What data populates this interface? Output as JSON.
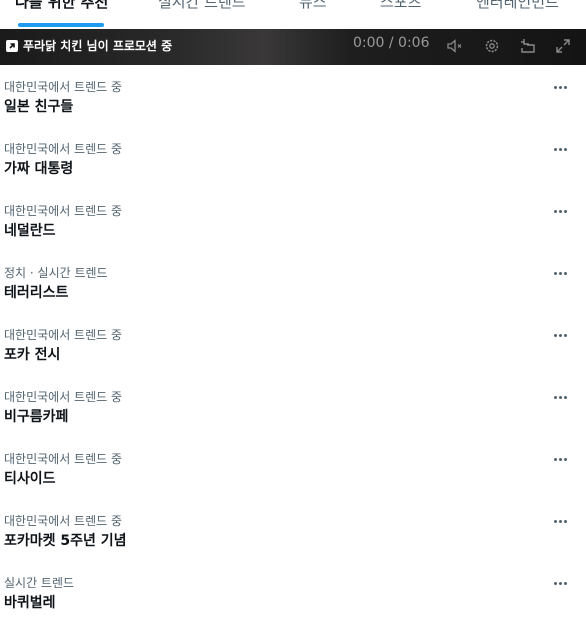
{
  "tabs": [
    {
      "label": "나를 위한 추천",
      "active": true
    },
    {
      "label": "실시간 트렌드",
      "active": false
    },
    {
      "label": "뉴스",
      "active": false
    },
    {
      "label": "스포츠",
      "active": false
    },
    {
      "label": "엔터테인먼트",
      "active": false
    }
  ],
  "promo": {
    "badge_icon": "arrow-up-right-icon",
    "text": "푸라닭 치킨 님이 프로모션 중",
    "time": "0:00 / 0:06",
    "controls": [
      "mute-icon",
      "settings-gear-icon",
      "minimize-icon",
      "fullscreen-icon"
    ]
  },
  "trends": [
    {
      "meta": "대한민국에서 트렌드 중",
      "name": "일본 친구들"
    },
    {
      "meta": "대한민국에서 트렌드 중",
      "name": "가짜 대통령"
    },
    {
      "meta": "대한민국에서 트렌드 중",
      "name": "네덜란드"
    },
    {
      "meta": "정치 · 실시간 트렌드",
      "name": "테러리스트"
    },
    {
      "meta": "대한민국에서 트렌드 중",
      "name": "포카 전시"
    },
    {
      "meta": "대한민국에서 트렌드 중",
      "name": "비구름카페"
    },
    {
      "meta": "대한민국에서 트렌드 중",
      "name": "티사이드"
    },
    {
      "meta": "대한민국에서 트렌드 중",
      "name": "포카마켓 5주년 기념"
    },
    {
      "meta": "실시간 트렌드",
      "name": "바퀴벌레"
    }
  ],
  "more_icon": "more-options-icon",
  "colors": {
    "accent": "#1d9bf0",
    "text": "#0f1419",
    "secondary": "#536471"
  }
}
